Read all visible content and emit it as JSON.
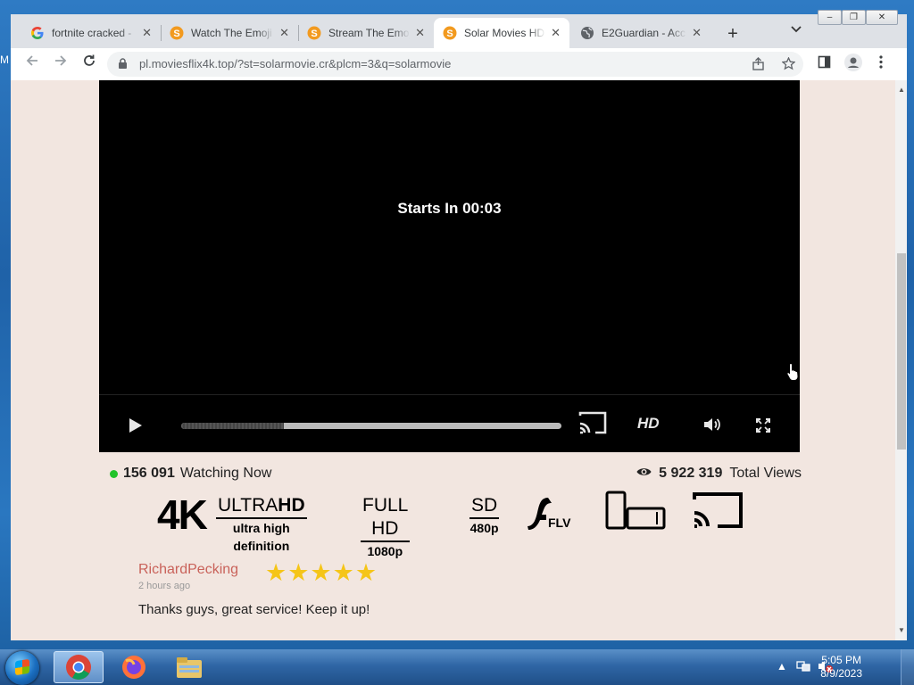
{
  "desktop": {
    "edge_letter": "M"
  },
  "window_controls": {
    "minimize": "–",
    "restore": "❐",
    "close": "✕"
  },
  "tabs": [
    {
      "title": "fortnite cracked -",
      "icon": "google-g-icon"
    },
    {
      "title": "Watch The Emoji",
      "icon": "solar-s-icon"
    },
    {
      "title": "Stream The Emoji",
      "icon": "solar-s-icon"
    },
    {
      "title": "Solar Movies HD",
      "icon": "solar-s-icon",
      "active": true
    },
    {
      "title": "E2Guardian - Acc",
      "icon": "globe-icon"
    }
  ],
  "toolbar": {
    "url": "pl.moviesflix4k.top/?st=solarmovie.cr&plcm=3&q=solarmovie",
    "new_tab": "+",
    "tab_menu": "⌄"
  },
  "player": {
    "countdown_text": "Starts In 00:03",
    "progress_fraction": 0.27,
    "hd_label": "HD"
  },
  "stats": {
    "watching_count": "156 091",
    "watching_label": "Watching Now",
    "views_count": "5 922 319",
    "views_label": "Total Views"
  },
  "badges": {
    "k4": "4K",
    "ultra_top_a": "ULTRA",
    "ultra_top_b": "HD",
    "ultra_bottom": "ultra high definition",
    "fullhd_top": "FULL HD",
    "fullhd_bottom": "1080p",
    "sd_top": "SD",
    "sd_bottom": "480p",
    "flv_label": "FLV"
  },
  "review": {
    "name": "RichardPecking",
    "time": "2 hours ago",
    "rating": 5,
    "stars": "★★★★★",
    "text": "Thanks guys, great service! Keep it up!"
  },
  "taskbar": {
    "time": "5:05 PM",
    "date": "8/9/2023"
  },
  "colors": {
    "page_bg": "#f2e6e0",
    "reviewer_name": "#c9625a",
    "star": "#f5c518",
    "online_dot": "#22c32a"
  }
}
